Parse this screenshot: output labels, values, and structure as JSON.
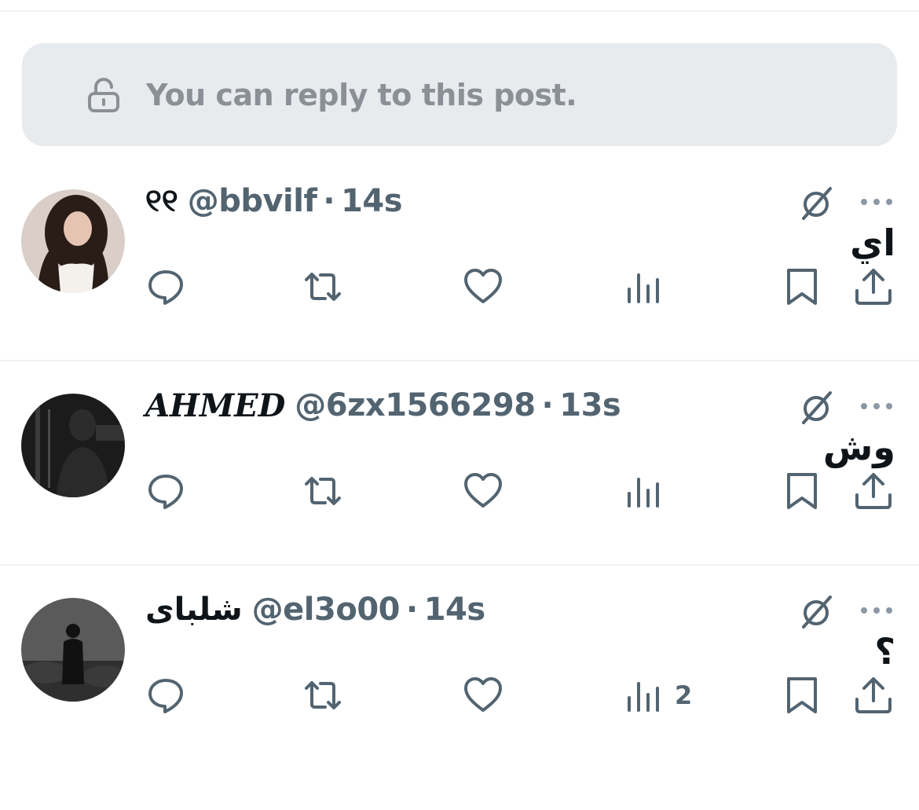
{
  "banner": {
    "text": "You can reply to this post.",
    "icon": "unlock-icon"
  },
  "colors": {
    "secondary_text": "#536471",
    "primary_text": "#0f1419",
    "banner_bg": "#e8ebee"
  },
  "replies": [
    {
      "display_name": "୧୧",
      "handle": "@bbvilf",
      "separator": "·",
      "time": "14s",
      "text": "اي",
      "views": ""
    },
    {
      "display_name": "AHMED",
      "handle": "@6zx1566298",
      "separator": "·",
      "time": "13s",
      "text": "وش",
      "views": ""
    },
    {
      "display_name": "شلباى",
      "handle": "@el3o00",
      "separator": "·",
      "time": "14s",
      "text": "؟",
      "views": "2"
    }
  ]
}
